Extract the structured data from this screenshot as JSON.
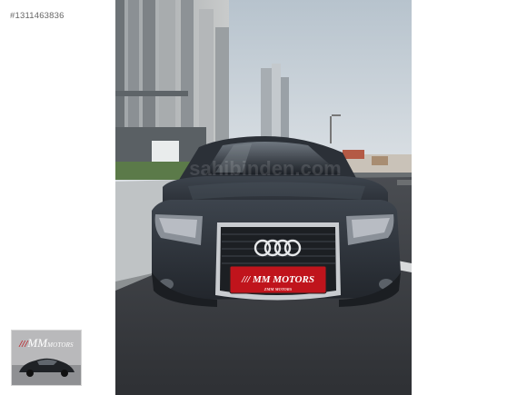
{
  "listing": {
    "id_label": "#1311463836"
  },
  "main_photo": {
    "plate_main": "/// MM MOTORS",
    "plate_sub": "ZMM MOTORS",
    "watermark": "sahibinden.com"
  },
  "thumbnail": {
    "slashes": "///",
    "brand": "MM",
    "suffix": "MOTORS"
  },
  "colors": {
    "brand_red": "#c0141c",
    "car_body": "#2b3037",
    "sky": "#cdd5dc"
  }
}
